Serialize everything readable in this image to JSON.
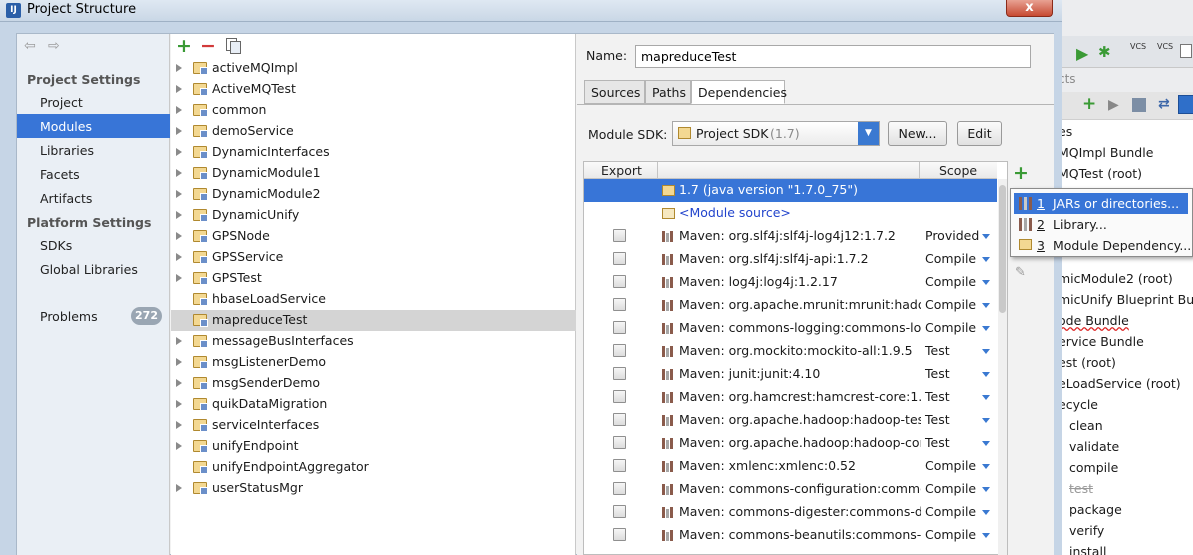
{
  "window": {
    "title": "Project Structure",
    "app_icon": "intellij-icon",
    "close": "x"
  },
  "left_nav": {
    "back": "⇦",
    "forward": "⇨",
    "project_settings_header": "Project Settings",
    "project_settings": [
      "Project",
      "Modules",
      "Libraries",
      "Facets",
      "Artifacts"
    ],
    "platform_settings_header": "Platform Settings",
    "platform_settings": [
      "SDKs",
      "Global Libraries"
    ],
    "problems_label": "Problems",
    "problems_count": "272",
    "selected": "Modules"
  },
  "tree_toolbar": {
    "add": "+",
    "remove": "−",
    "copy": "copy-icon"
  },
  "modules": [
    {
      "name": "activeMQImpl",
      "expandable": true
    },
    {
      "name": "ActiveMQTest",
      "expandable": true
    },
    {
      "name": "common",
      "expandable": true
    },
    {
      "name": "demoService",
      "expandable": true
    },
    {
      "name": "DynamicInterfaces",
      "expandable": true
    },
    {
      "name": "DynamicModule1",
      "expandable": true
    },
    {
      "name": "DynamicModule2",
      "expandable": true
    },
    {
      "name": "DynamicUnify",
      "expandable": true
    },
    {
      "name": "GPSNode",
      "expandable": true
    },
    {
      "name": "GPSService",
      "expandable": true
    },
    {
      "name": "GPSTest",
      "expandable": true
    },
    {
      "name": "hbaseLoadService",
      "expandable": false
    },
    {
      "name": "mapreduceTest",
      "expandable": false,
      "selected": true
    },
    {
      "name": "messageBusInterfaces",
      "expandable": true
    },
    {
      "name": "msgListenerDemo",
      "expandable": true
    },
    {
      "name": "msgSenderDemo",
      "expandable": true
    },
    {
      "name": "quikDataMigration",
      "expandable": true
    },
    {
      "name": "serviceInterfaces",
      "expandable": true
    },
    {
      "name": "unifyEndpoint",
      "expandable": true
    },
    {
      "name": "unifyEndpointAggregator",
      "expandable": false
    },
    {
      "name": "userStatusMgr",
      "expandable": true
    }
  ],
  "details": {
    "name_label": "Name:",
    "name_value": "mapreduceTest",
    "tabs": [
      "Sources",
      "Paths",
      "Dependencies"
    ],
    "active_tab": "Dependencies",
    "sdk_label": "Module SDK:",
    "sdk_value": "Project SDK",
    "sdk_version": "(1.7)",
    "new_button": "New...",
    "edit_button": "Edit"
  },
  "dependencies": {
    "col_export": "Export",
    "col_scope": "Scope",
    "rows": [
      {
        "name": "1.7 (java version \"1.7.0_75\")",
        "scope": "",
        "checkbox": false,
        "icon": "sdk-folder-icon",
        "selected": true
      },
      {
        "name": "<Module source>",
        "scope": "",
        "checkbox": false,
        "icon": "module-source-icon",
        "link": true
      },
      {
        "name": "Maven: org.slf4j:slf4j-log4j12:1.7.2",
        "scope": "Provided",
        "checkbox": true
      },
      {
        "name": "Maven: org.slf4j:slf4j-api:1.7.2",
        "scope": "Compile",
        "checkbox": true
      },
      {
        "name": "Maven: log4j:log4j:1.2.17",
        "scope": "Compile",
        "checkbox": true
      },
      {
        "name": "Maven: org.apache.mrunit:mrunit:hadoop",
        "scope": "Compile",
        "checkbox": true
      },
      {
        "name": "Maven: commons-logging:commons-logg",
        "scope": "Compile",
        "checkbox": true
      },
      {
        "name": "Maven: org.mockito:mockito-all:1.9.5",
        "scope": "Test",
        "checkbox": true
      },
      {
        "name": "Maven: junit:junit:4.10",
        "scope": "Test",
        "checkbox": true
      },
      {
        "name": "Maven: org.hamcrest:hamcrest-core:1.1",
        "scope": "Test",
        "checkbox": true
      },
      {
        "name": "Maven: org.apache.hadoop:hadoop-test:",
        "scope": "Test",
        "checkbox": true
      },
      {
        "name": "Maven: org.apache.hadoop:hadoop-core",
        "scope": "Test",
        "checkbox": true
      },
      {
        "name": "Maven: xmlenc:xmlenc:0.52",
        "scope": "Compile",
        "checkbox": true
      },
      {
        "name": "Maven: commons-configuration:commons",
        "scope": "Compile",
        "checkbox": true
      },
      {
        "name": "Maven: commons-digester:commons-dig",
        "scope": "Compile",
        "checkbox": true
      },
      {
        "name": "Maven: commons-beanutils:commons-be",
        "scope": "Compile",
        "checkbox": true
      }
    ],
    "add_button": "+",
    "edit_icon": "pencil-icon"
  },
  "add_popup": {
    "items": [
      {
        "num": "1",
        "label": "JARs or directories...",
        "icon": "jar-icon",
        "selected": true
      },
      {
        "num": "2",
        "label": "Library...",
        "icon": "library-icon"
      },
      {
        "num": "3",
        "label": "Module Dependency...",
        "icon": "module-folder-icon"
      }
    ]
  },
  "background_ide": {
    "toolbar_texts": [
      "VCS",
      "VCS"
    ],
    "panel_title": "cts",
    "list_header": "es",
    "items": [
      "MQImpl Bundle",
      "MQTest (root)",
      "",
      "",
      "",
      "",
      "",
      "micModule2 (root)",
      "micUnify Blueprint Bund",
      "ode Bundle",
      "ervice Bundle",
      "est (root)",
      "eLoadService (root)",
      "ecycle",
      "clean",
      "validate",
      "compile",
      "test",
      "package",
      "verify",
      "install"
    ]
  },
  "colors": {
    "selection": "#3875d7",
    "accent_add": "#3a9a35",
    "accent_remove": "#d23a3a"
  }
}
